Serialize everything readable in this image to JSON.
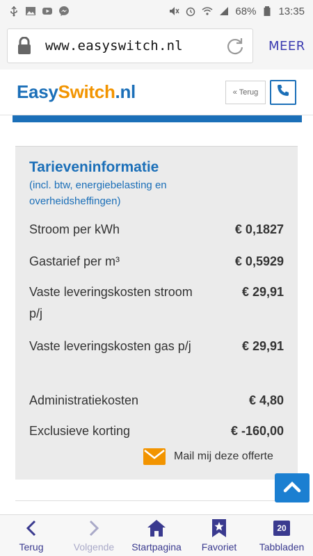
{
  "status_bar": {
    "battery": "68%",
    "time": "13:35"
  },
  "browser": {
    "url": "www.easyswitch.nl",
    "menu_label": "MEER"
  },
  "site_header": {
    "logo_easy": "Easy",
    "logo_switch": "Switch",
    "logo_nl": ".nl",
    "back_label": "« Terug"
  },
  "card": {
    "title": "Tarieveninformatie",
    "subtitle": "(incl. btw, energiebelasting en overheidsheffingen)",
    "rows": [
      {
        "label": "Stroom per kWh",
        "value": "€ 0,1827"
      },
      {
        "label": "Gastarief per m³",
        "value": "€ 0,5929"
      },
      {
        "label": "Vaste leveringskosten stroom p/j",
        "value": "€ 29,91"
      },
      {
        "label": "Vaste leveringskosten gas p/j",
        "value": "€ 29,91"
      },
      {
        "label": "Administratiekosten",
        "value": "€ 4,80"
      },
      {
        "label": "Exclusieve korting",
        "value": "€ -160,00"
      }
    ],
    "mail_label": "Mail mij deze offerte"
  },
  "bottom_nav": {
    "items": [
      {
        "label": "Terug",
        "icon": "chevron-left-icon"
      },
      {
        "label": "Volgende",
        "icon": "chevron-right-icon"
      },
      {
        "label": "Startpagina",
        "icon": "home-icon"
      },
      {
        "label": "Favoriet",
        "icon": "bookmark-star-icon"
      },
      {
        "label": "Tabbladen",
        "icon": "tabs-icon",
        "count": "20"
      }
    ]
  },
  "colors": {
    "brand_blue": "#1b6fb8",
    "brand_orange": "#f29400",
    "nav_purple": "#3a3a8f"
  }
}
